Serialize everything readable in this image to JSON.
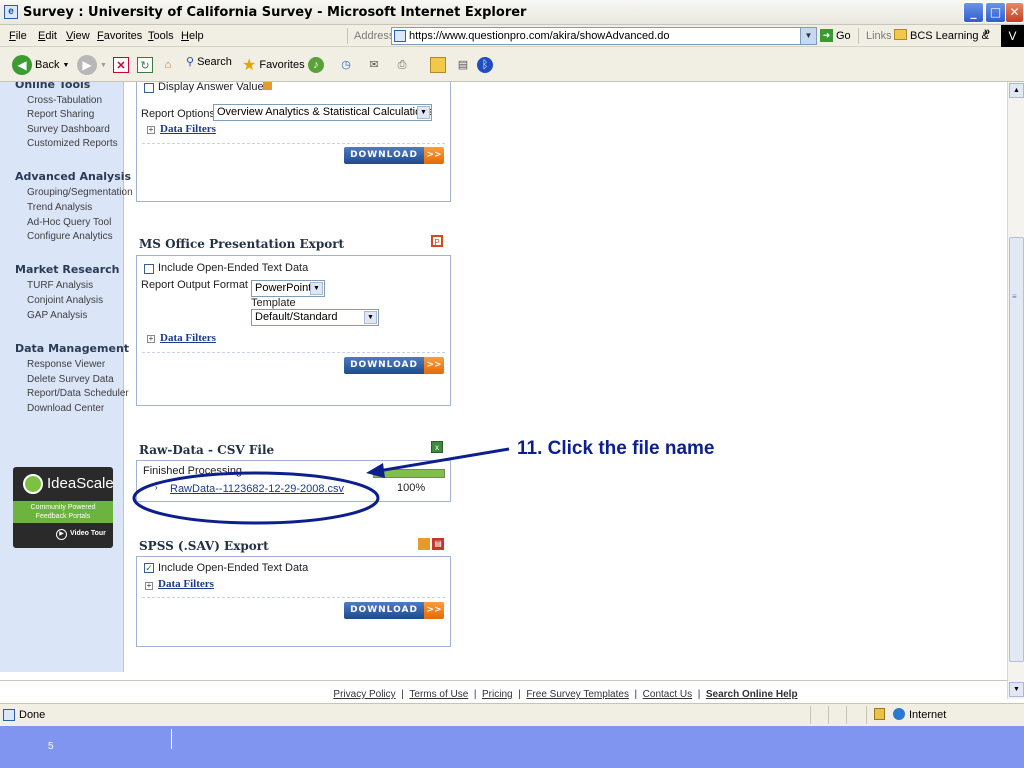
{
  "window": {
    "title": "Survey : University of California Survey - Microsoft Internet Explorer",
    "min": "_",
    "max": "□",
    "close": "✕"
  },
  "menu": [
    "File",
    "Edit",
    "View",
    "Favorites",
    "Tools",
    "Help"
  ],
  "address": {
    "label": "Address",
    "url": "https://www.questionpro.com/akira/showAdvanced.do",
    "go": "Go"
  },
  "links": {
    "label": "Links",
    "item": "BCS Learning &",
    "more": "»",
    "extra": "V"
  },
  "toolbar": {
    "back": "Back",
    "search": "Search",
    "favorites": "Favorites"
  },
  "sidebar": {
    "sections": [
      {
        "heading": "Online Tools",
        "items": [
          "Cross-Tabulation",
          "Report Sharing",
          "Survey Dashboard",
          "Customized Reports"
        ]
      },
      {
        "heading": "Advanced Analysis",
        "items": [
          "Grouping/Segmentation",
          "Trend Analysis",
          "Ad-Hoc Query Tool",
          "Configure Analytics"
        ]
      },
      {
        "heading": "Market Research",
        "items": [
          "TURF Analysis",
          "Conjoint Analysis",
          "GAP Analysis"
        ]
      },
      {
        "heading": "Data Management",
        "items": [
          "Response Viewer",
          "Delete Survey Data",
          "Report/Data Scheduler",
          "Download Center"
        ]
      }
    ],
    "ad": {
      "brand": "IdeaScale",
      "tagline_1": "Community Powered",
      "tagline_2": "Feedback Portals",
      "video": "Video Tour"
    }
  },
  "overview": {
    "display_answers": "Display Answer Values",
    "report_options_label": "Report Options",
    "report_options_value": "Overview Analytics & Statistical Calculations",
    "data_filters": "Data Filters",
    "download": "DOWNLOAD",
    "arrow": ">>"
  },
  "ms_office": {
    "title": "MS Office Presentation Export",
    "include_text": "Include Open-Ended Text Data",
    "output_format_label": "Report Output Format",
    "output_format_value": "PowerPoint",
    "template_label": "Template",
    "template_value": "Default/Standard",
    "data_filters": "Data Filters",
    "download": "DOWNLOAD",
    "arrow": ">>"
  },
  "raw_data": {
    "title": "Raw-Data - CSV File",
    "status": "Finished Processing",
    "progress": 1.0,
    "file_name": "RawData--1123682-12-29-2008.csv",
    "percent": "100%"
  },
  "spss": {
    "title": "SPSS (.SAV) Export",
    "include_text": "Include Open-Ended Text Data",
    "data_filters": "Data Filters",
    "download": "DOWNLOAD",
    "arrow": ">>"
  },
  "callout": "11.  Click the file name",
  "footer": [
    "Privacy Policy",
    "Terms of Use",
    "Pricing",
    "Free Survey Templates",
    "Contact Us",
    "Search Online Help"
  ],
  "status": {
    "text": "Done",
    "zone": "Internet"
  },
  "slide_number": "5",
  "colors": {
    "accent": "#1f4a8c",
    "orange": "#e36a08",
    "sidebar": "#dbe5f8",
    "callout": "#0d1f8c",
    "slide": "#7f95f0"
  }
}
